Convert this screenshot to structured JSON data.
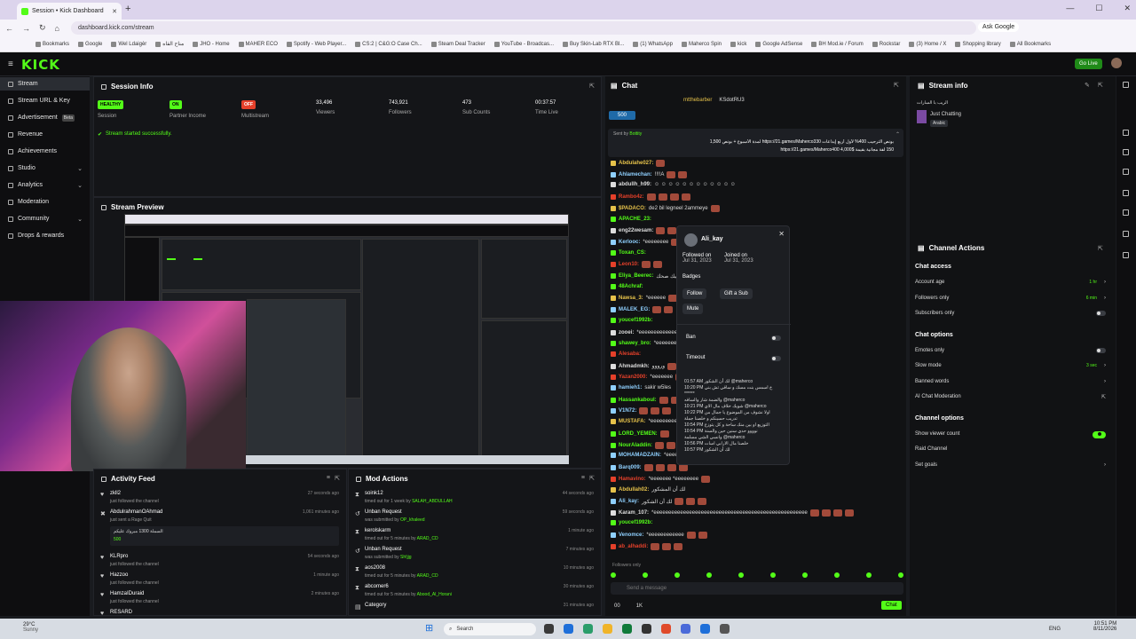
{
  "browser": {
    "tab_title": "Session • Kick Dashboard",
    "url": "dashboard.kick.com/stream",
    "ask_google": "Ask Google",
    "bookmarks": [
      "Bookmarks",
      "Google",
      "Wel Ldaigèr",
      "مناح القاه",
      "JHO - Home",
      "MAHER ECO",
      "Spotify - Web Player...",
      "CS:2 | C&G:O Case Ch...",
      "Steam Deal Tracker",
      "YouTube - Broadcas...",
      "Buy Skin-Lab RTX Bl...",
      "(1) WhatsApp",
      "Maherco Spin",
      "kick",
      "Google AdSense",
      "BH Mod.ie / Forum",
      "Rockstar",
      "(3) Home / X",
      "Shopping library",
      "All Bookmarks"
    ]
  },
  "header": {
    "logo": "KICK",
    "go_live": "Go Live"
  },
  "sidebar": {
    "items": [
      {
        "label": "Stream",
        "active": true
      },
      {
        "label": "Stream URL & Key"
      },
      {
        "label": "Advertisement",
        "badge": "Beta"
      },
      {
        "label": "Revenue"
      },
      {
        "label": "Achievements"
      },
      {
        "label": "Studio",
        "chevron": "⌄"
      },
      {
        "label": "Analytics",
        "chevron": "⌄"
      },
      {
        "label": "Moderation"
      },
      {
        "label": "Community",
        "chevron": "⌄"
      },
      {
        "label": "Drops & rewards"
      }
    ]
  },
  "session": {
    "title": "Session Info",
    "stats": [
      {
        "value": "HEALTHY",
        "label": "Session",
        "color": "#53fc18"
      },
      {
        "value": "ON",
        "label": "Partner Income",
        "color": "#53fc18"
      },
      {
        "value": "OFF",
        "label": "Multistream",
        "color": "#e5402a"
      },
      {
        "value": "33,496",
        "label": "Viewers"
      },
      {
        "value": "743,921",
        "label": "Followers"
      },
      {
        "value": "473",
        "label": "Sub Counts"
      },
      {
        "value": "00:37:57",
        "label": "Time Live"
      }
    ],
    "status": "Stream started successfully."
  },
  "preview": {
    "title": "Stream Preview"
  },
  "activity": {
    "title": "Activity Feed",
    "rows": [
      {
        "name": "zkll2",
        "sub": "just followed the channel",
        "time": "27 seconds ago",
        "icon": "♥"
      },
      {
        "name": "AbdulrahmanOAhmad",
        "sub": "just sent a Rage Quit",
        "time": "1,061 minutes ago",
        "icon": "✖",
        "msg": "السملة 1300 مبروك عليكم",
        "amount": "500"
      },
      {
        "name": "KLRpro",
        "sub": "just followed the channel",
        "time": "54 seconds ago",
        "icon": "♥"
      },
      {
        "name": "Hazzoo",
        "sub": "just followed the channel",
        "time": "1 minute ago",
        "icon": "♥"
      },
      {
        "name": "HamzaIDuraid",
        "sub": "just followed the channel",
        "time": "2 minutes ago",
        "icon": "♥"
      },
      {
        "name": "RESARD",
        "sub": "",
        "time": "",
        "icon": "♥"
      }
    ]
  },
  "modactions": {
    "title": "Mod Actions",
    "rows": [
      {
        "name": "soink12",
        "sub": "timed out for 1 week by",
        "by": "SALAH_ABDULLAH",
        "time": "44 seconds ago",
        "icon": "⧗"
      },
      {
        "name": "Unban Request",
        "sub": "was submitted by",
        "by": "OP_khaleed",
        "time": "59 seconds ago",
        "icon": "↺"
      },
      {
        "name": "kerolskarm",
        "sub": "timed out for 5 minutes by",
        "by": "ARAD_CD",
        "time": "1 minute ago",
        "icon": "⧗"
      },
      {
        "name": "Unban Request",
        "sub": "was submitted by",
        "by": "Sh!jjg",
        "time": "7 minutes ago",
        "icon": "↺"
      },
      {
        "name": "aos2008",
        "sub": "timed out for 5 minutes by",
        "by": "ARAD_CD",
        "time": "10 minutes ago",
        "icon": "⧗"
      },
      {
        "name": "abcomer6",
        "sub": "timed out for 5 minutes by",
        "by": "Abood_Al_Horani",
        "time": "30 minutes ago",
        "icon": "⧗"
      },
      {
        "name": "Category",
        "sub": "",
        "by": "",
        "time": "31 minutes ago",
        "icon": "▤"
      }
    ]
  },
  "chat": {
    "title": "Chat",
    "top_user": "mtthebarber",
    "top_user2": "KSdotRU3",
    "pinned_sender": "Sent by",
    "pinned_by": "Bottity",
    "pinned_text": "بونص الترحيب 400% لأول أربع إيداعات https://21.games/Maherco330 لمدة الأسبوع + بونص 1,500",
    "pinned_text2": "150 لفة مجانية بقيمة $4,000 https://21.games/Maherco400",
    "count": "500",
    "lines": [
      {
        "u": "Abdulahe027:",
        "c": "#e6c24a",
        "t": ""
      },
      {
        "u": "Ahlamechan:",
        "c": "#8fd0ff",
        "t": "!!!!A"
      },
      {
        "u": "abdullh_h99:",
        "c": "#ddd",
        "t": "☺ ☺ ☺ ☺ ☺ ☺ ☺ ☺ ☺ ☺ ☺ ☺"
      },
      {
        "u": "Rambo4z:",
        "c": "#e5402a",
        "t": ""
      },
      {
        "u": "$PADACO:",
        "c": "#e6c24a",
        "t": "de2 bil legneel 2ammeye"
      },
      {
        "u": "APACHE_23:",
        "c": "#53fc18",
        "t": ""
      },
      {
        "u": "eng22wesam:",
        "c": "#ddd",
        "t": ""
      },
      {
        "u": "Kerlooc:",
        "c": "#8fd0ff",
        "t": "*eeeeeeee"
      },
      {
        "u": "Toxan_CS:",
        "c": "#53fc18",
        "t": ""
      },
      {
        "u": "Leon10:",
        "c": "#e5402a",
        "t": ""
      },
      {
        "u": "Eliya_Beerec:",
        "c": "#53fc18",
        "t": "خليك صحك"
      },
      {
        "u": "48Achraf:",
        "c": "#53fc18",
        "t": ""
      },
      {
        "u": "Nawsa_3:",
        "c": "#e6c24a",
        "t": "*eeeeee"
      },
      {
        "u": "MALEK_EG:",
        "c": "#8fd0ff",
        "t": ""
      },
      {
        "u": "youcef1992b:",
        "c": "#53fc18",
        "t": ""
      },
      {
        "u": "zooei:",
        "c": "#ddd",
        "t": "*eeeeeeeeeeeeeeee"
      },
      {
        "u": "shawey_bro:",
        "c": "#53fc18",
        "t": "*eeeeeeeeeeeeeeee"
      },
      {
        "u": "Alesaba:",
        "c": "#e5402a",
        "t": ""
      },
      {
        "u": "Ahmadmkh:",
        "c": "#ddd",
        "t": "ورووو"
      },
      {
        "u": "Yazan2000:",
        "c": "#e5402a",
        "t": "*eeeeeee"
      },
      {
        "u": "hamieh1:",
        "c": "#8fd0ff",
        "t": "sakir w5les"
      },
      {
        "u": "Hassankaboul:",
        "c": "#53fc18",
        "t": ""
      },
      {
        "u": "V1N72:",
        "c": "#8fd0ff",
        "t": ""
      },
      {
        "u": "MUSTAFA:",
        "c": "#e6c24a",
        "t": "*eeeeeeeeeee"
      },
      {
        "u": "LORD_YEMEN:",
        "c": "#53fc18",
        "t": ""
      },
      {
        "u": "NourAladdin:",
        "c": "#53fc18",
        "t": ""
      },
      {
        "u": "MOHAMADZAIN:",
        "c": "#8fd0ff",
        "t": "*eeeeeeeeee"
      },
      {
        "u": "Barq009:",
        "c": "#8fd0ff",
        "t": ""
      },
      {
        "u": "Hamavino:",
        "c": "#e5402a",
        "t": "*eeeeeee *eeeeeeee"
      },
      {
        "u": "Abdullah02:",
        "c": "#e6c24a",
        "t": "لك أن المشكور"
      },
      {
        "u": "Ali_kay:",
        "c": "#8fd0ff",
        "t": "لك أن الشكور"
      },
      {
        "u": "Karam_107:",
        "c": "#ddd",
        "t": "*eeeeeeeeeeeeeeeeeeeeeeeeeeeeeeeeeeeeeeeeeeeeeeeeeeee"
      },
      {
        "u": "youcef1992b:",
        "c": "#53fc18",
        "t": ""
      },
      {
        "u": "Venomce:",
        "c": "#8fd0ff",
        "t": "*eeeeeeeeeeee"
      },
      {
        "u": "ab_alhaddi:",
        "c": "#e5402a",
        "t": ""
      }
    ],
    "followers_only": "Followers only",
    "placeholder": "Send a message",
    "points": "00",
    "kicks": "1K",
    "send": "Chat"
  },
  "userpopup": {
    "username": "Ali_kay",
    "followed_label": "Followed on",
    "followed_date": "Jul 31, 2023",
    "joined_label": "Joined on",
    "joined_date": "Jul 31, 2023",
    "badges": "Badges",
    "follow": "Follow",
    "gift": "Gift a Sub",
    "mute": "Mute",
    "ban": "Ban",
    "timeout": "Timeout",
    "messages": [
      "01:57 AM لك أن الشكور @maherco",
      "10:20 PM خ اسمس بنت مسك و ساقي تش بني ******",
      "والضمة شار والسافه @maherco",
      "10:21 PM شويك خلاف مال الاي @maherco",
      "10:22 PM اولا نشوف من الموضوع يا جمال من",
      "تدريب حسينكم و خلصنا جملة",
      "10:54 PM التوزيع او بين منك ساحة و كل يتوزع",
      "10:54 PM نوووو حدي سنين حين والسنة",
      "وانسي الشي مسلمة @maherco",
      "10:56 PM خلصنا مال الارابي اسات",
      "10:57 PM لك أن الشكور"
    ]
  },
  "streaminfo": {
    "title": "Stream info",
    "stream_title": "الريب با السارات",
    "category": "Just Chatting",
    "language": "Arabic"
  },
  "channelactions": {
    "title": "Channel Actions",
    "sections": [
      {
        "heading": "Chat access",
        "rows": [
          {
            "label": "Account age",
            "value": "1 hr",
            "kind": "value"
          },
          {
            "label": "Followers only",
            "value": "6 min",
            "kind": "value"
          },
          {
            "label": "Subscribers only",
            "kind": "toggle",
            "on": false
          }
        ]
      },
      {
        "heading": "Chat options",
        "rows": [
          {
            "label": "Emotes only",
            "kind": "toggle",
            "on": false
          },
          {
            "label": "Slow mode",
            "value": "3 sec",
            "kind": "value"
          },
          {
            "label": "Banned words",
            "kind": "chevron"
          },
          {
            "label": "AI Chat Moderation",
            "kind": "ext"
          }
        ]
      },
      {
        "heading": "Channel options",
        "rows": [
          {
            "label": "Show viewer count",
            "kind": "toggle",
            "on": true
          },
          {
            "label": "Raid Channel",
            "kind": "none"
          },
          {
            "label": "Set goals",
            "kind": "chevron"
          }
        ]
      }
    ]
  },
  "taskbar": {
    "weather": "29°C",
    "weather_sub": "Sunny",
    "search": "Search",
    "lang": "ENG",
    "time": "10:51 PM",
    "date": "8/11/2026"
  }
}
